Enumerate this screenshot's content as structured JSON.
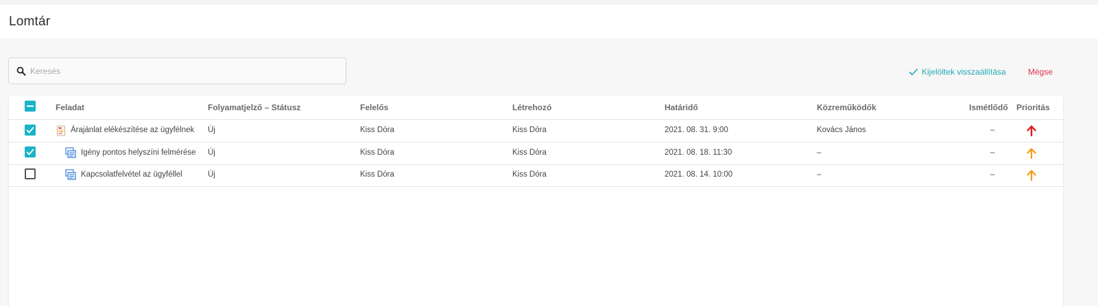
{
  "page": {
    "title": "Lomtár"
  },
  "search": {
    "placeholder": "Keresés",
    "value": ""
  },
  "actions": {
    "restore_label": "Kijelöltek visszaállítása",
    "cancel_label": "Mégse"
  },
  "colors": {
    "accent": "#1ab3c7",
    "cancel": "#e0304e",
    "priority_high": "#e0191b",
    "priority_medium": "#f39a11"
  },
  "table": {
    "select_all_state": "indeterminate",
    "headers": {
      "task": "Feladat",
      "status": "Folyamatjelző – Státusz",
      "responsible": "Felelős",
      "creator": "Létrehozó",
      "deadline": "Határidő",
      "contributors": "Közreműködők",
      "recurring": "Ismétlődő",
      "priority": "Prioritás"
    },
    "rows": [
      {
        "checked": true,
        "icon": "quote-document-icon",
        "task": "Árajánlat elékészítése az ügyfélnek",
        "status": "Új",
        "responsible": "Kiss Dóra",
        "creator": "Kiss Dóra",
        "deadline": "2021. 08. 31. 9:00",
        "contributors": "Kovács János",
        "recurring": "–",
        "priority": "high"
      },
      {
        "checked": true,
        "icon": "survey-task-icon",
        "task": "Igény pontos helyszíni felmérése",
        "status": "Új",
        "responsible": "Kiss Dóra",
        "creator": "Kiss Dóra",
        "deadline": "2021. 08. 18. 11:30",
        "contributors": "–",
        "recurring": "–",
        "priority": "medium"
      },
      {
        "checked": false,
        "icon": "survey-task-icon",
        "task": "Kapcsolatfelvétel az ügyféllel",
        "status": "Új",
        "responsible": "Kiss Dóra",
        "creator": "Kiss Dóra",
        "deadline": "2021. 08. 14. 10:00",
        "contributors": "–",
        "recurring": "–",
        "priority": "medium"
      }
    ]
  }
}
